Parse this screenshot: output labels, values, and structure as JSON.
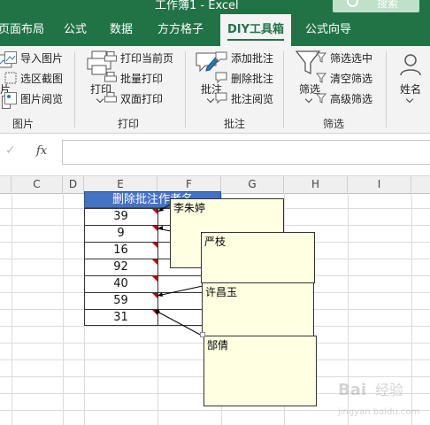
{
  "window": {
    "title": "工作簿1 - Excel",
    "search": "搜索"
  },
  "tabs": [
    {
      "label": "页面布局"
    },
    {
      "label": "公式"
    },
    {
      "label": "数据"
    },
    {
      "label": "方方格子"
    },
    {
      "label": "DIY工具箱",
      "active": true
    },
    {
      "label": "公式向导"
    }
  ],
  "ribbon": {
    "image_group": {
      "partial_label": "片",
      "import_image": "导入图片",
      "select_screenshot": "选区截图",
      "image_browse": "图片阅览",
      "name": "图片"
    },
    "print_group": {
      "print": "打印",
      "print_current_page": "打印当前页",
      "batch_print": "批量打印",
      "duplex_print": "双面打印",
      "name": "打印"
    },
    "comment_group": {
      "comment": "批注",
      "add_comment": "添加批注",
      "delete_comment": "删除批注",
      "browse_comment": "批注阅览",
      "name": "批注"
    },
    "filter_group": {
      "filter": "筛选",
      "filter_selected": "筛选选中",
      "clear_filter": "清空筛选",
      "advanced_filter": "高级筛选",
      "name": "筛选"
    },
    "name_group": {
      "name_label": "姓名"
    }
  },
  "formula_bar": {
    "cancel": "✓",
    "fx": "fx",
    "value": ""
  },
  "grid": {
    "columns": [
      "C",
      "D",
      "E",
      "F",
      "G",
      "H",
      "I"
    ],
    "header_cell": "删除批注作者名",
    "values": [
      "39",
      "9",
      "16",
      "92",
      "40",
      "59",
      "31"
    ],
    "comments": [
      "李朱婷",
      "严枝",
      "许昌玉",
      "郜倩"
    ]
  },
  "colors": {
    "accent": "#217346",
    "header_fill": "#4472c4",
    "comment_fill": "#ffffe1",
    "indicator": "#c00000"
  },
  "watermark": "Baidu 经验 jingyan.baidu.com"
}
